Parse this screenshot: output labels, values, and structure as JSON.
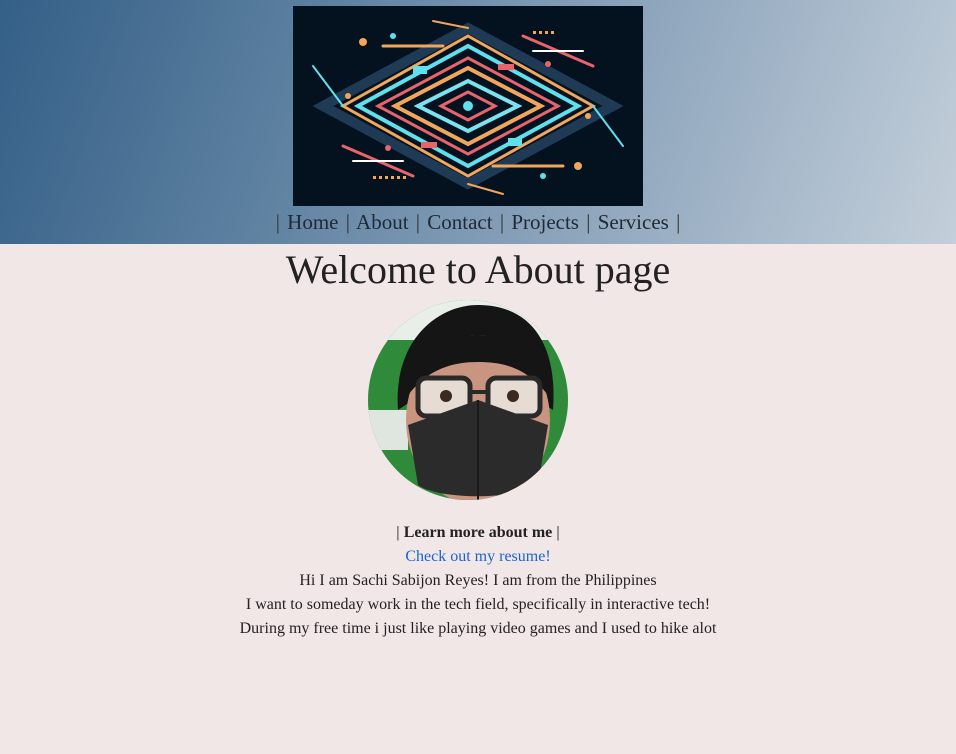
{
  "header": {
    "logo_icon": "circuit-board-logo",
    "nav": [
      {
        "label": "Home"
      },
      {
        "label": "About"
      },
      {
        "label": "Contact"
      },
      {
        "label": "Projects"
      },
      {
        "label": "Services"
      }
    ],
    "separator": "|"
  },
  "main": {
    "title": "Welcome to About page",
    "avatar_icon": "profile-photo",
    "learn_more": "Learn more about me",
    "resume_link": "Check out my resume!",
    "paragraphs": [
      "Hi I am Sachi Sabijon Reyes! I am from the Philippines",
      "I want to someday work in the tech field, specifically in interactive tech!",
      "During my free time i just like playing video games and I used to hike alot"
    ]
  },
  "colors": {
    "page_bg": "#f2e7e7",
    "header_gradient_start": "#345f87",
    "header_gradient_end": "#c3cfda",
    "link": "#1a62d6",
    "logo_bg": "#04111f"
  }
}
